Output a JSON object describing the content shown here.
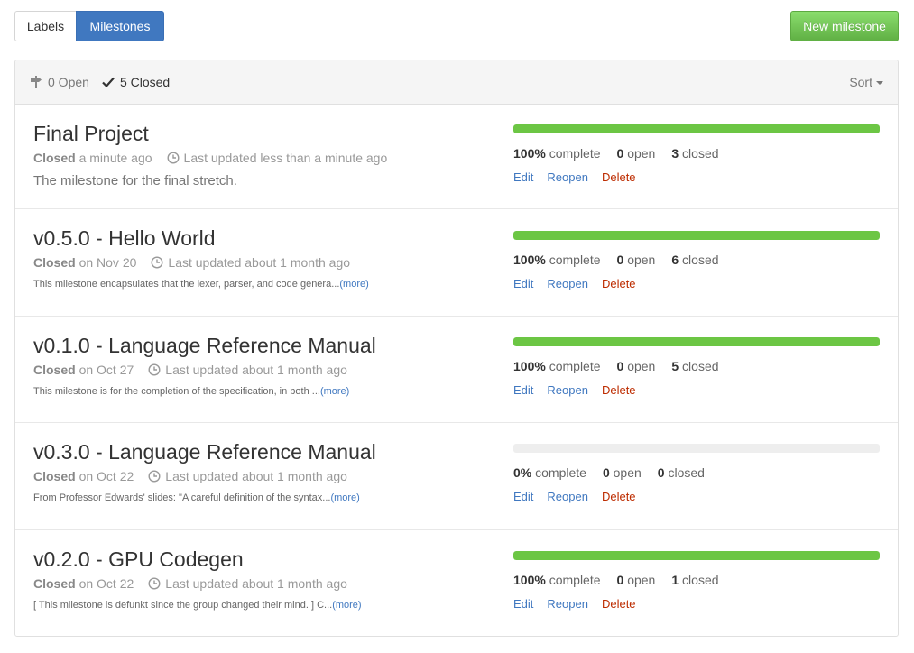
{
  "tabs": {
    "labels": "Labels",
    "milestones": "Milestones"
  },
  "new_milestone": "New milestone",
  "header": {
    "open": "0 Open",
    "closed": "5 Closed",
    "sort": "Sort"
  },
  "colors": {
    "accent": "#4078c0",
    "progress": "#6cc644",
    "delete": "#bd2c00",
    "new_button": "#60b044"
  },
  "milestones": [
    {
      "title": "Final Project",
      "closed_label": "Closed",
      "closed_when": "a minute ago",
      "updated": "Last updated less than a minute ago",
      "description": "The milestone for the final stretch.",
      "more": "",
      "percent_num": "100%",
      "percent_label": "complete",
      "open_num": "0",
      "open_label": "open",
      "closed_num": "3",
      "closed_label2": "closed",
      "progress": 1.0,
      "edit": "Edit",
      "reopen": "Reopen",
      "delete": "Delete"
    },
    {
      "title": "v0.5.0 - Hello World",
      "closed_label": "Closed",
      "closed_when": "on Nov 20",
      "updated": "Last updated about 1 month ago",
      "description": "This milestone encapsulates that the lexer, parser, and code genera...",
      "more": "(more)",
      "percent_num": "100%",
      "percent_label": "complete",
      "open_num": "0",
      "open_label": "open",
      "closed_num": "6",
      "closed_label2": "closed",
      "progress": 1.0,
      "edit": "Edit",
      "reopen": "Reopen",
      "delete": "Delete"
    },
    {
      "title": "v0.1.0 - Language Reference Manual",
      "closed_label": "Closed",
      "closed_when": "on Oct 27",
      "updated": "Last updated about 1 month ago",
      "description": "This milestone is for the completion of the specification, in both ...",
      "more": "(more)",
      "percent_num": "100%",
      "percent_label": "complete",
      "open_num": "0",
      "open_label": "open",
      "closed_num": "5",
      "closed_label2": "closed",
      "progress": 1.0,
      "edit": "Edit",
      "reopen": "Reopen",
      "delete": "Delete"
    },
    {
      "title": "v0.3.0 - Language Reference Manual",
      "closed_label": "Closed",
      "closed_when": "on Oct 22",
      "updated": "Last updated about 1 month ago",
      "description": "From Professor Edwards' slides: \"A careful definition of the syntax...",
      "more": "(more)",
      "percent_num": "0%",
      "percent_label": "complete",
      "open_num": "0",
      "open_label": "open",
      "closed_num": "0",
      "closed_label2": "closed",
      "progress": 0.0,
      "edit": "Edit",
      "reopen": "Reopen",
      "delete": "Delete"
    },
    {
      "title": "v0.2.0 - GPU Codegen",
      "closed_label": "Closed",
      "closed_when": "on Oct 22",
      "updated": "Last updated about 1 month ago",
      "description": "[ This milestone is defunkt since the group changed their mind. ] C...",
      "more": "(more)",
      "percent_num": "100%",
      "percent_label": "complete",
      "open_num": "0",
      "open_label": "open",
      "closed_num": "1",
      "closed_label2": "closed",
      "progress": 1.0,
      "edit": "Edit",
      "reopen": "Reopen",
      "delete": "Delete"
    }
  ]
}
